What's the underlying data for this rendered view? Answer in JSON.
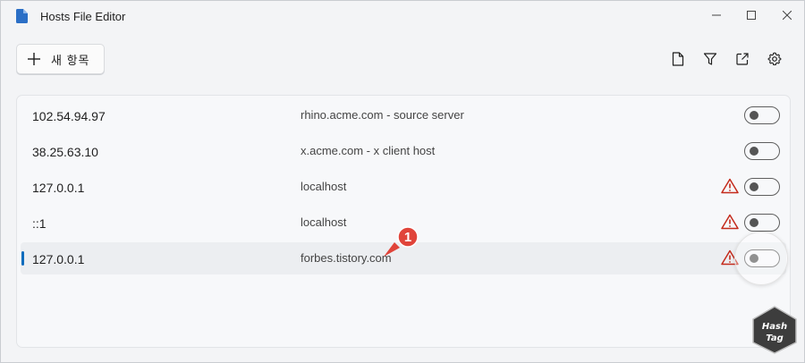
{
  "window": {
    "title": "Hosts File Editor"
  },
  "toolbar": {
    "new_entry_label": "새 항목"
  },
  "entries": [
    {
      "ip": "102.54.94.97",
      "host": "rhino.acme.com - source server",
      "warning": false,
      "active": false,
      "selected": false
    },
    {
      "ip": "38.25.63.10",
      "host": "x.acme.com - x client host",
      "warning": false,
      "active": false,
      "selected": false
    },
    {
      "ip": "127.0.0.1",
      "host": "localhost",
      "warning": true,
      "active": false,
      "selected": false
    },
    {
      "ip": "::1",
      "host": "localhost",
      "warning": true,
      "active": false,
      "selected": false
    },
    {
      "ip": "127.0.0.1",
      "host": "forbes.tistory.com",
      "warning": true,
      "active": false,
      "selected": true
    }
  ],
  "annotation": {
    "callout_number": "1",
    "watermark_line1": "Hash",
    "watermark_line2": "Tag"
  },
  "colors": {
    "accent": "#0f6cbd",
    "warning": "#c42b1c",
    "callout": "#e0443a"
  }
}
